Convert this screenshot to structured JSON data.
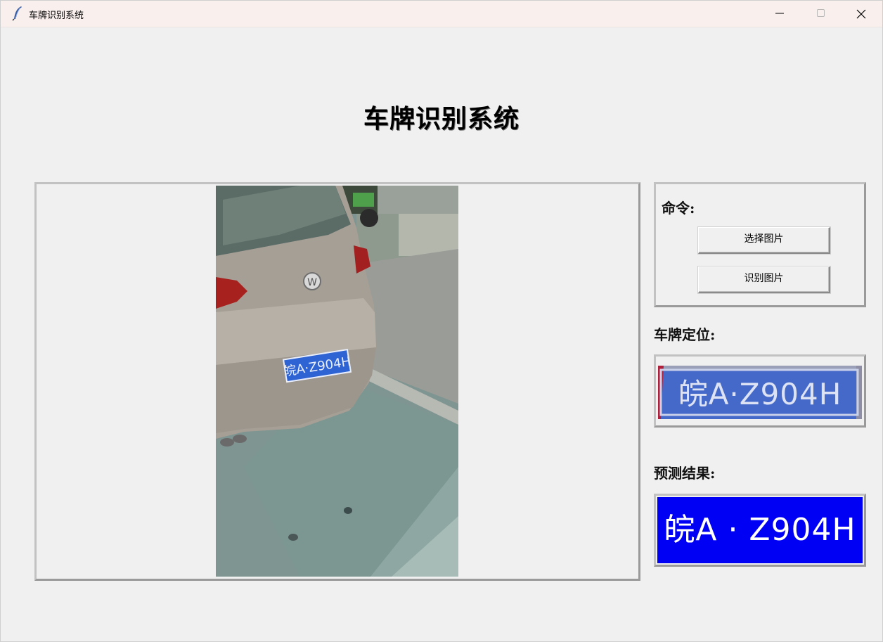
{
  "window": {
    "title": "车牌识别系统",
    "controls": [
      "minimize",
      "maximize",
      "close"
    ]
  },
  "page": {
    "title": "车牌识别系统"
  },
  "image_panel": {
    "plate_text_in_photo": "皖A·Z904H"
  },
  "command_panel": {
    "label": "命令:",
    "buttons": {
      "select_image": "选择图片",
      "recognize_image": "识别图片"
    }
  },
  "plate_location": {
    "label": "车牌定位:",
    "crop_text": "皖A·Z904H"
  },
  "prediction": {
    "label": "预测结果:",
    "result": "皖A · Z904H",
    "background_color": "#0000f5",
    "text_color": "#ffffff"
  },
  "icons": {
    "app": "feather-icon",
    "minimize": "minimize-icon",
    "maximize": "maximize-icon",
    "close": "close-icon"
  }
}
